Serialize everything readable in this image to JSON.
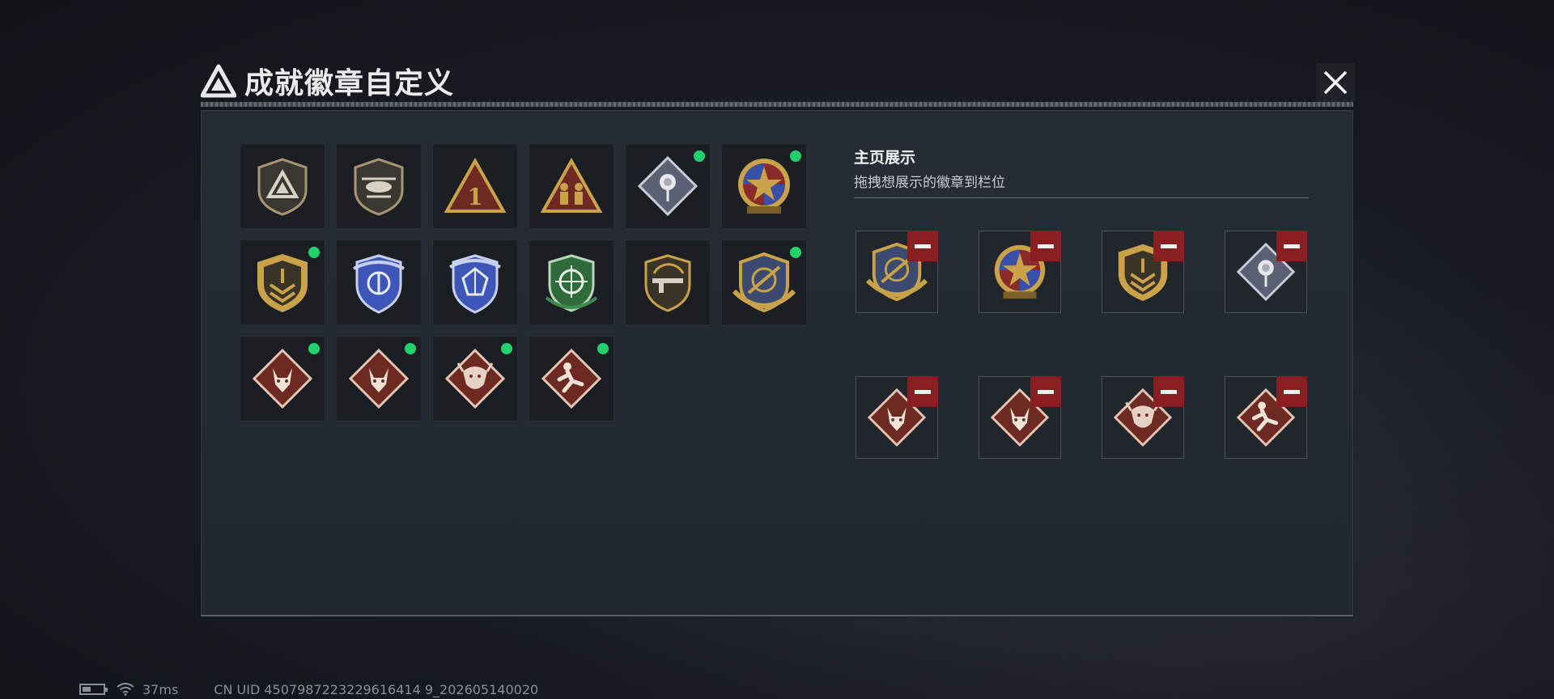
{
  "header": {
    "title": "成就徽章自定义",
    "logo_icon": "delta-logo-icon"
  },
  "close_icon": "close-icon",
  "badges": [
    {
      "icon": "delta-shield-badge-icon",
      "equipped": false
    },
    {
      "icon": "helicopter-shield-badge-icon",
      "equipped": false
    },
    {
      "icon": "number-one-triangle-badge-icon",
      "equipped": false
    },
    {
      "icon": "squad-triangle-badge-icon",
      "equipped": false
    },
    {
      "icon": "rose-diamond-badge-icon",
      "equipped": true
    },
    {
      "icon": "star-emblem-badge-icon",
      "equipped": true
    },
    {
      "icon": "gold-chevron-shield-badge-icon",
      "equipped": true
    },
    {
      "icon": "blue-winged-shield-badge-icon",
      "equipped": false
    },
    {
      "icon": "blue-gem-shield-badge-icon",
      "equipped": false
    },
    {
      "icon": "green-crosshair-badge-icon",
      "equipped": false
    },
    {
      "icon": "rifle-shield-badge-icon",
      "equipped": false
    },
    {
      "icon": "gold-crosshair-wings-badge-icon",
      "equipped": true
    },
    {
      "icon": "wolf-diamond-badge-icon",
      "equipped": true
    },
    {
      "icon": "wolf-diamond-badge-icon",
      "equipped": true
    },
    {
      "icon": "dragon-diamond-badge-icon",
      "equipped": true
    },
    {
      "icon": "runner-diamond-badge-icon",
      "equipped": true
    }
  ],
  "showcase": {
    "title": "主页展示",
    "subtitle": "拖拽想展示的徽章到栏位",
    "slots": [
      "gold-crosshair-wings-badge-icon",
      "star-emblem-badge-icon",
      "gold-chevron-shield-badge-icon",
      "rose-diamond-badge-icon",
      "wolf-diamond-badge-icon",
      "wolf-diamond-badge-icon",
      "dragon-diamond-badge-icon",
      "runner-diamond-badge-icon"
    ],
    "remove_icon": "minus-icon"
  },
  "status": {
    "ping": "37ms",
    "uid": "CN UID 4507987223229616414 9_202605140020"
  },
  "colors": {
    "equipped_dot": "#22d06e",
    "remove_red": "#8a1e20",
    "gold": "#c9a24a"
  }
}
